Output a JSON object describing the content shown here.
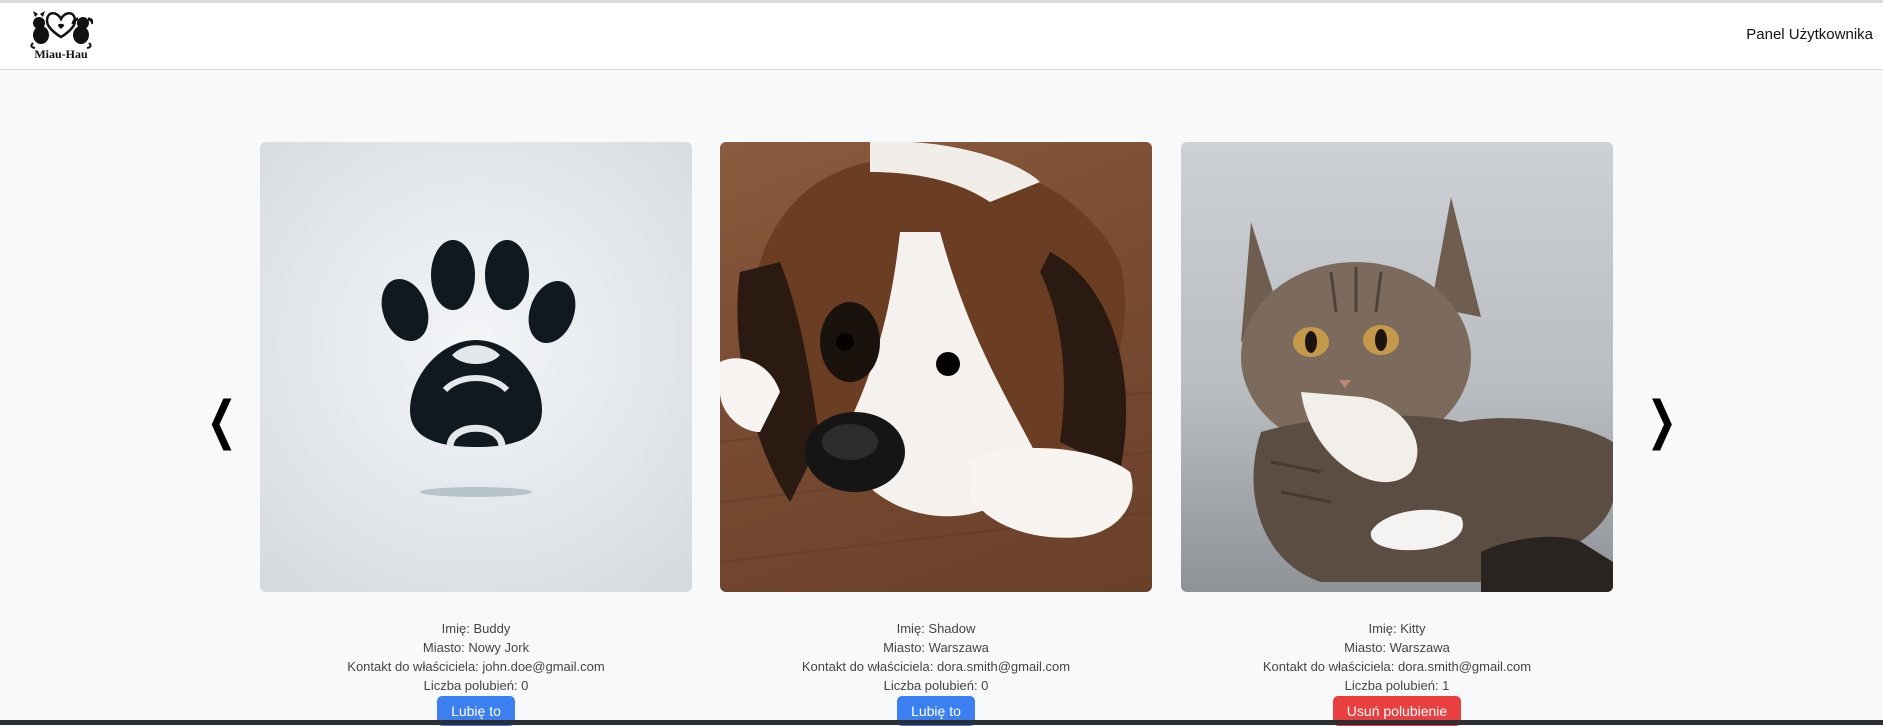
{
  "navbar": {
    "logo_text": "Miau-Hau",
    "user_panel": "Panel Użytkownika"
  },
  "carousel": {
    "prev_icon": "chevron-left-icon",
    "next_icon": "chevron-right-icon",
    "prev_label": "❮",
    "next_label": "❯"
  },
  "cards": [
    {
      "image": "paw-placeholder-image",
      "name": "Imię: Buddy",
      "city": "Miasto: Nowy Jork",
      "contact": "Kontakt do właściciela: john.doe@gmail.com",
      "likes": "Liczba polubień: 0",
      "button": "Lubię to"
    },
    {
      "image": "boxer-puppy-photo",
      "name": "Imię: Shadow",
      "city": "Miasto: Warszawa",
      "contact": "Kontakt do właściciela: dora.smith@gmail.com",
      "likes": "Liczba polubień: 0",
      "button": "Lubię to"
    },
    {
      "image": "tabby-kitten-photo",
      "name": "Imię: Kitty",
      "city": "Miasto: Warszawa",
      "contact": "Kontakt do właściciela: dora.smith@gmail.com",
      "likes": "Liczba polubień: 1",
      "button": "Usuń polubienie"
    }
  ],
  "colors": {
    "like_button": "#3b7ff0",
    "unlike_button": "#e9403f",
    "page_background": "#f7f9fb"
  }
}
